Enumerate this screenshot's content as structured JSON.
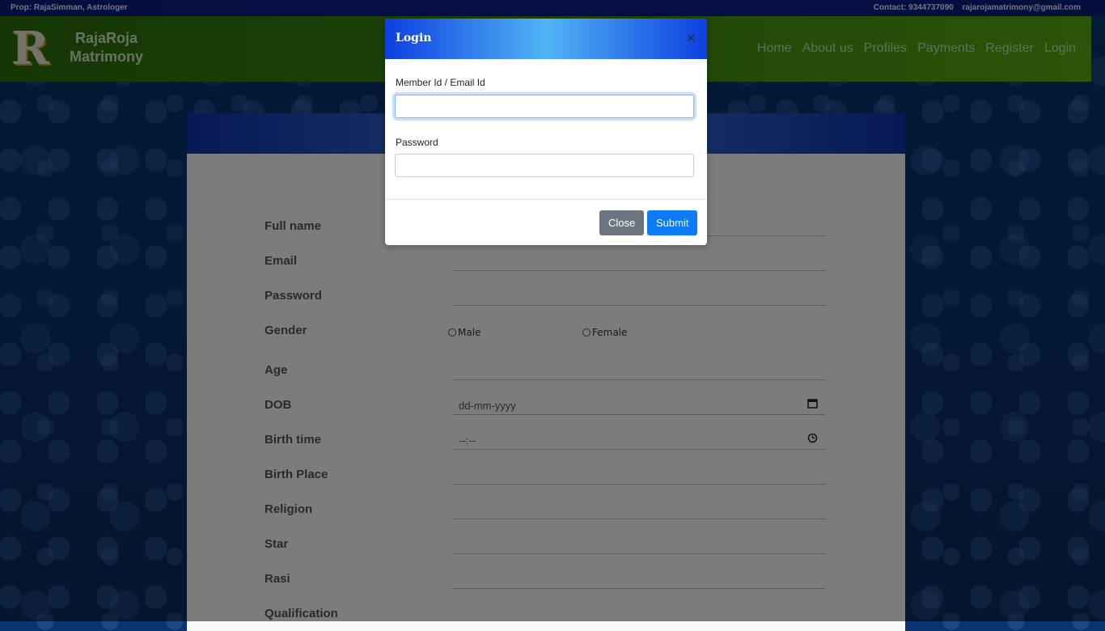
{
  "topbar": {
    "left": "Prop: RajaSimman, Astrologer",
    "contact": "Contact: 9344737090",
    "email": "rajarojamatrimony@gmail.com"
  },
  "brand": {
    "logo_letter": "R",
    "line1": "RajaRoja",
    "line2": "Matrimony"
  },
  "nav": [
    "Home",
    "About us",
    "Profiles",
    "Payments",
    "Register",
    "Login"
  ],
  "form": {
    "labels": {
      "full_name": "Full name",
      "email": "Email",
      "password": "Password",
      "gender": "Gender",
      "age": "Age",
      "dob": "DOB",
      "birth_time": "Birth time",
      "birth_place": "Birth Place",
      "religion": "Religion",
      "star": "Star",
      "rasi": "Rasi",
      "qualification": "Qualification"
    },
    "gender_options": [
      "Male",
      "Female"
    ],
    "dob_placeholder": "dd-mm-yyyy",
    "time_placeholder": "--:--"
  },
  "modal": {
    "title": "Login",
    "close_x": "×",
    "member_label": "Member Id / Email Id",
    "password_label": "Password",
    "close_button": "Close",
    "submit_button": "Submit",
    "member_value": "",
    "password_value": ""
  },
  "colors": {
    "navbar": "#3b8a0f",
    "topbar": "#0c1e8c",
    "submit": "#0d7bf5",
    "close": "#6c757d"
  }
}
